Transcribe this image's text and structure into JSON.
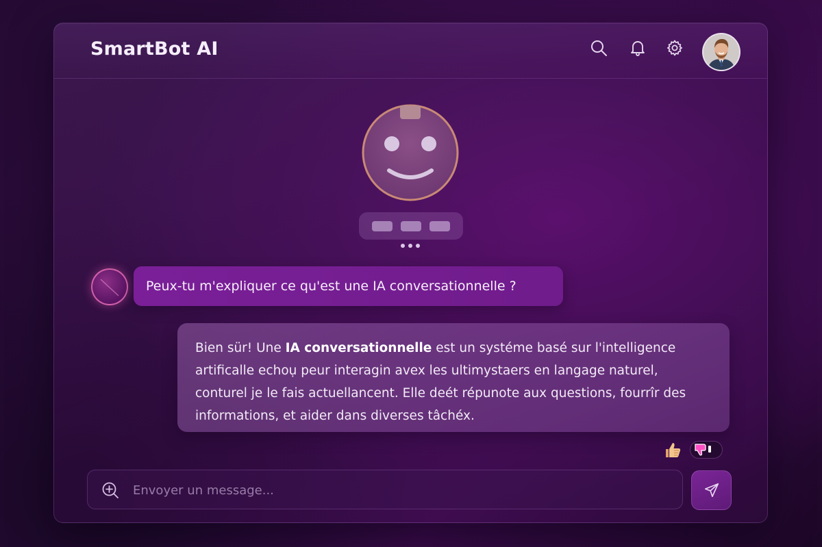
{
  "header": {
    "title": "SmartBot AI",
    "icons": [
      "search-icon",
      "bell-icon",
      "gear-icon"
    ],
    "avatar": "user-avatar-photo"
  },
  "bot_status": {
    "face": "smiley-bot-icon",
    "typing_indicator": "typing-dots"
  },
  "messages": [
    {
      "role": "user",
      "text": "Peux-tu m'expliquer ce qu'est une IA conversationnelle ?"
    },
    {
      "role": "bot",
      "text_before": "Bien sür! Une ",
      "text_emphasis": "IA conversationnelle",
      "text_after": " est un systéme basé sur l'intelligence artificalle echoụ peur interagin avex les ultimystaers en langage naturel, conturel je le fais actuellancent. Elle deét répunote aux questions, fourrîr des informations, et aider dans diverses tâchéx."
    }
  ],
  "reactions": {
    "thumbs_up": "thumbs-up-icon",
    "thumbs_down": "thumbs-down-icon"
  },
  "composer": {
    "placeholder": "Envoyer un message...",
    "value": ""
  },
  "colors": {
    "accent": "#7a1f98",
    "background": "#2d0c3e",
    "highlight": "#e94bc4"
  }
}
